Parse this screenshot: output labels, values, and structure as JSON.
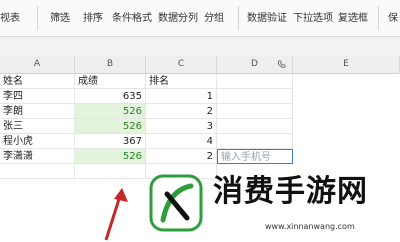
{
  "ribbon": {
    "items": [
      {
        "label": "视表"
      },
      {
        "label": "筛选"
      },
      {
        "label": "排序"
      },
      {
        "label": "条件格式"
      },
      {
        "label": "数据分列"
      },
      {
        "label": "分组"
      },
      {
        "label": "数据验证"
      },
      {
        "label": "下拉选项"
      },
      {
        "label": "复选框"
      },
      {
        "label": "保"
      }
    ]
  },
  "columns": [
    "A",
    "B",
    "C",
    "D",
    "E"
  ],
  "headers": {
    "name": "姓名",
    "score": "成绩",
    "rank": "排名"
  },
  "rows": [
    {
      "name": "李四",
      "score": "635",
      "rank": "1"
    },
    {
      "name": "李朗",
      "score": "526",
      "rank": "2"
    },
    {
      "name": "张三",
      "score": "526",
      "rank": "3"
    },
    {
      "name": "程小虎",
      "score": "367",
      "rank": "4"
    },
    {
      "name": "李潇潇",
      "score": "526",
      "rank": "2"
    }
  ],
  "highlighted_rows": [
    1,
    2,
    4
  ],
  "input_placeholder": "输入手机号",
  "watermark": {
    "title": "消费手游网",
    "url": "www.xinnanwang.com"
  },
  "colors": {
    "highlight": "#e2f4dc",
    "highlight_text": "#2f7d2a",
    "arrow": "#c62828",
    "watermark_green": "#2e9e3c"
  }
}
